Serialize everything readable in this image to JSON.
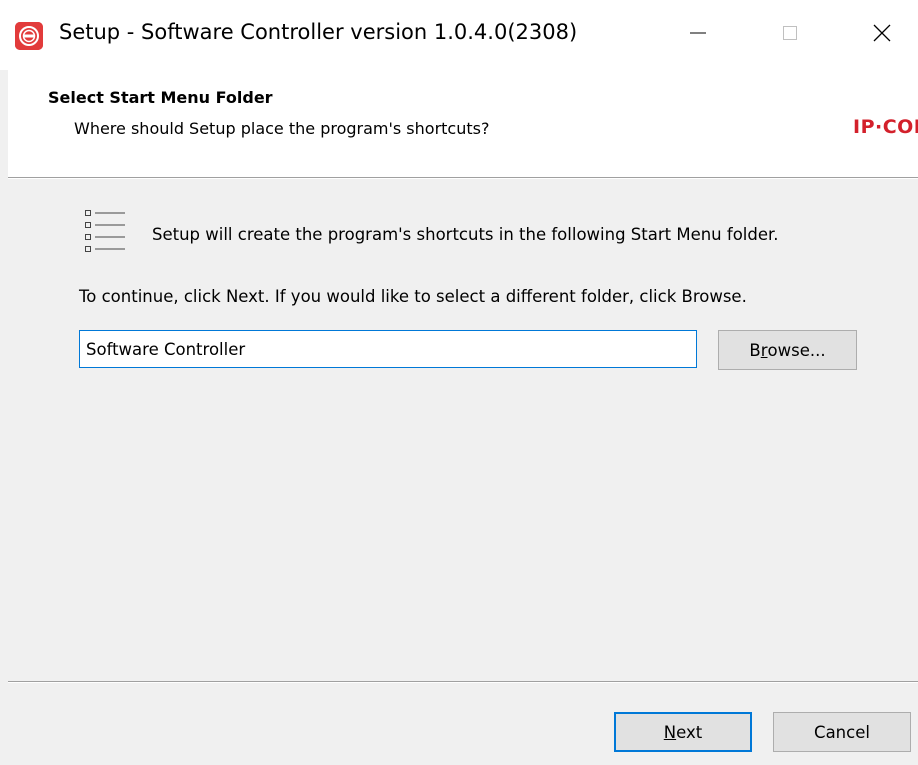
{
  "window": {
    "title": "Setup - Software Controller version 1.0.4.0(2308)",
    "app_icon": "red-circle-app-icon",
    "controls": {
      "minimize_icon": "minimize-icon",
      "maximize_icon": "maximize-icon",
      "close_icon": "close-icon"
    }
  },
  "header": {
    "title": "Select Start Menu Folder",
    "subtitle": "Where should Setup place the program's shortcuts?",
    "brand_logo": "IP·COM"
  },
  "body": {
    "list_icon": "list-icon",
    "info": "Setup will create the program's shortcuts in the following Start Menu folder.",
    "instruction": "To continue, click Next. If you would like to select a different folder, click Browse.",
    "folder_value": "Software Controller",
    "browse": {
      "pre": "B",
      "key": "r",
      "post": "owse..."
    }
  },
  "footer": {
    "next": {
      "pre": "",
      "key": "N",
      "post": "ext"
    },
    "cancel_label": "Cancel"
  },
  "colors": {
    "accent": "#0078d7",
    "brand": "#d3202b",
    "app_icon": "#e23b3b"
  }
}
